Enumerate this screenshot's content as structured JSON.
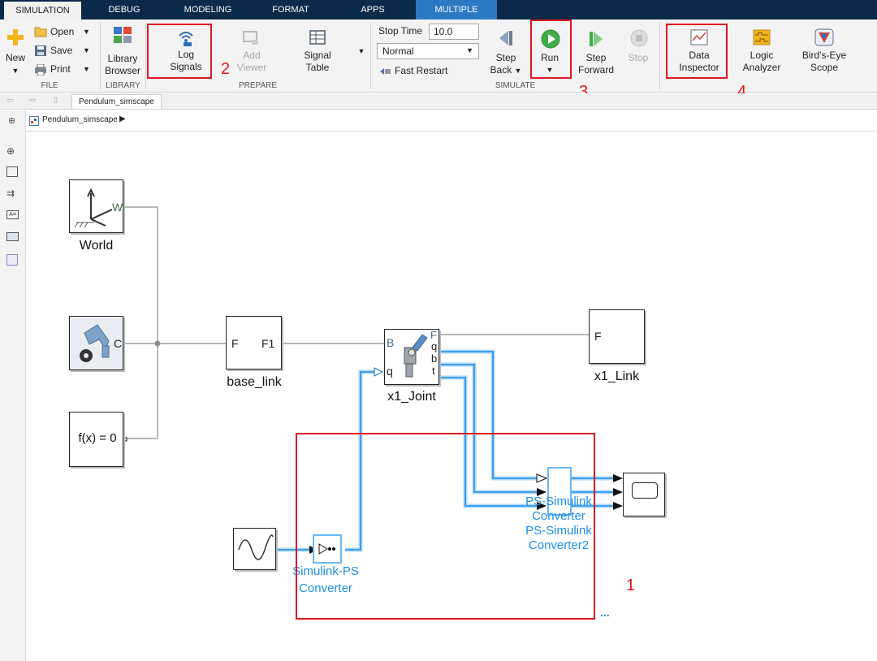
{
  "tabs": [
    "SIMULATION",
    "DEBUG",
    "MODELING",
    "FORMAT",
    "APPS",
    "MULTIPLE"
  ],
  "ribbon": {
    "file": {
      "new_label": "New",
      "open_label": "Open",
      "save_label": "Save",
      "print_label": "Print",
      "group": "FILE"
    },
    "library": {
      "browser_line1": "Library",
      "browser_line2": "Browser",
      "group": "LIBRARY"
    },
    "prepare": {
      "log_line1": "Log",
      "log_line2": "Signals",
      "viewer_line1": "Add",
      "viewer_line2": "Viewer",
      "table_line1": "Signal",
      "table_line2": "Table",
      "group": "PREPARE"
    },
    "simulate": {
      "stop_time_label": "Stop Time",
      "stop_time_value": "10.0",
      "mode_value": "Normal",
      "fast_restart_label": "Fast Restart",
      "step_back_line1": "Step",
      "step_back_line2": "Back",
      "run_label": "Run",
      "step_fwd_line1": "Step",
      "step_fwd_line2": "Forward",
      "stop_label": "Stop",
      "group": "SIMULATE"
    },
    "review": {
      "inspector_line1": "Data",
      "inspector_line2": "Inspector",
      "logic_line1": "Logic",
      "logic_line2": "Analyzer",
      "birds_line1": "Bird's-Eye",
      "birds_line2": "Scope"
    }
  },
  "annotations": [
    "1",
    "2",
    "3",
    "4"
  ],
  "nav": {
    "tab_title": "Pendulum_simscape"
  },
  "breadcrumb": {
    "model": "Pendulum_simscape"
  },
  "blocks": {
    "world": "World",
    "world_port": "W",
    "config_port": "C",
    "solver": "f(x) = 0",
    "base_link": "base_link",
    "base_port_f": "F",
    "base_port_f1": "F1",
    "x1_joint": "x1_Joint",
    "joint_port_b": "B",
    "joint_port_q_in": "q",
    "joint_port_f": "F",
    "joint_port_q": "q",
    "joint_port_b_out": "b",
    "joint_port_t": "t",
    "x1_link": "x1_Link",
    "x1_link_port": "F",
    "converter_line1": "Simulink-PS",
    "converter_line2": "Converter",
    "ps_line1": "PS-Simulink",
    "ps_line2": "Converter",
    "ps_line3": "PS-Simulink",
    "ps_line4": "Converter2",
    "ellipsis": "..."
  },
  "colors": {
    "accent": "#2b79c2",
    "tabbar": "#0b2a4a",
    "signal": "#1d8ee8",
    "annotation": "#e0141e"
  }
}
